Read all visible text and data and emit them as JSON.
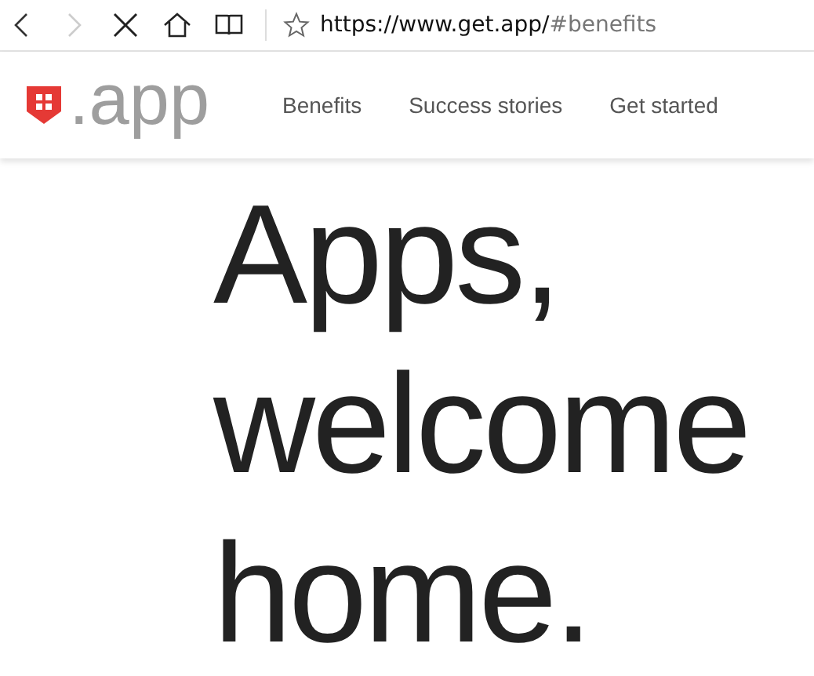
{
  "browser": {
    "back_disabled": false,
    "forward_disabled": true,
    "url_main": "https://www.get.app/",
    "url_fragment": "#benefits"
  },
  "site": {
    "logo_text": ".app",
    "nav": [
      {
        "label": "Benefits"
      },
      {
        "label": "Success stories"
      },
      {
        "label": "Get started"
      }
    ]
  },
  "hero": {
    "lines": [
      "Apps,",
      "welcome",
      "home."
    ]
  }
}
